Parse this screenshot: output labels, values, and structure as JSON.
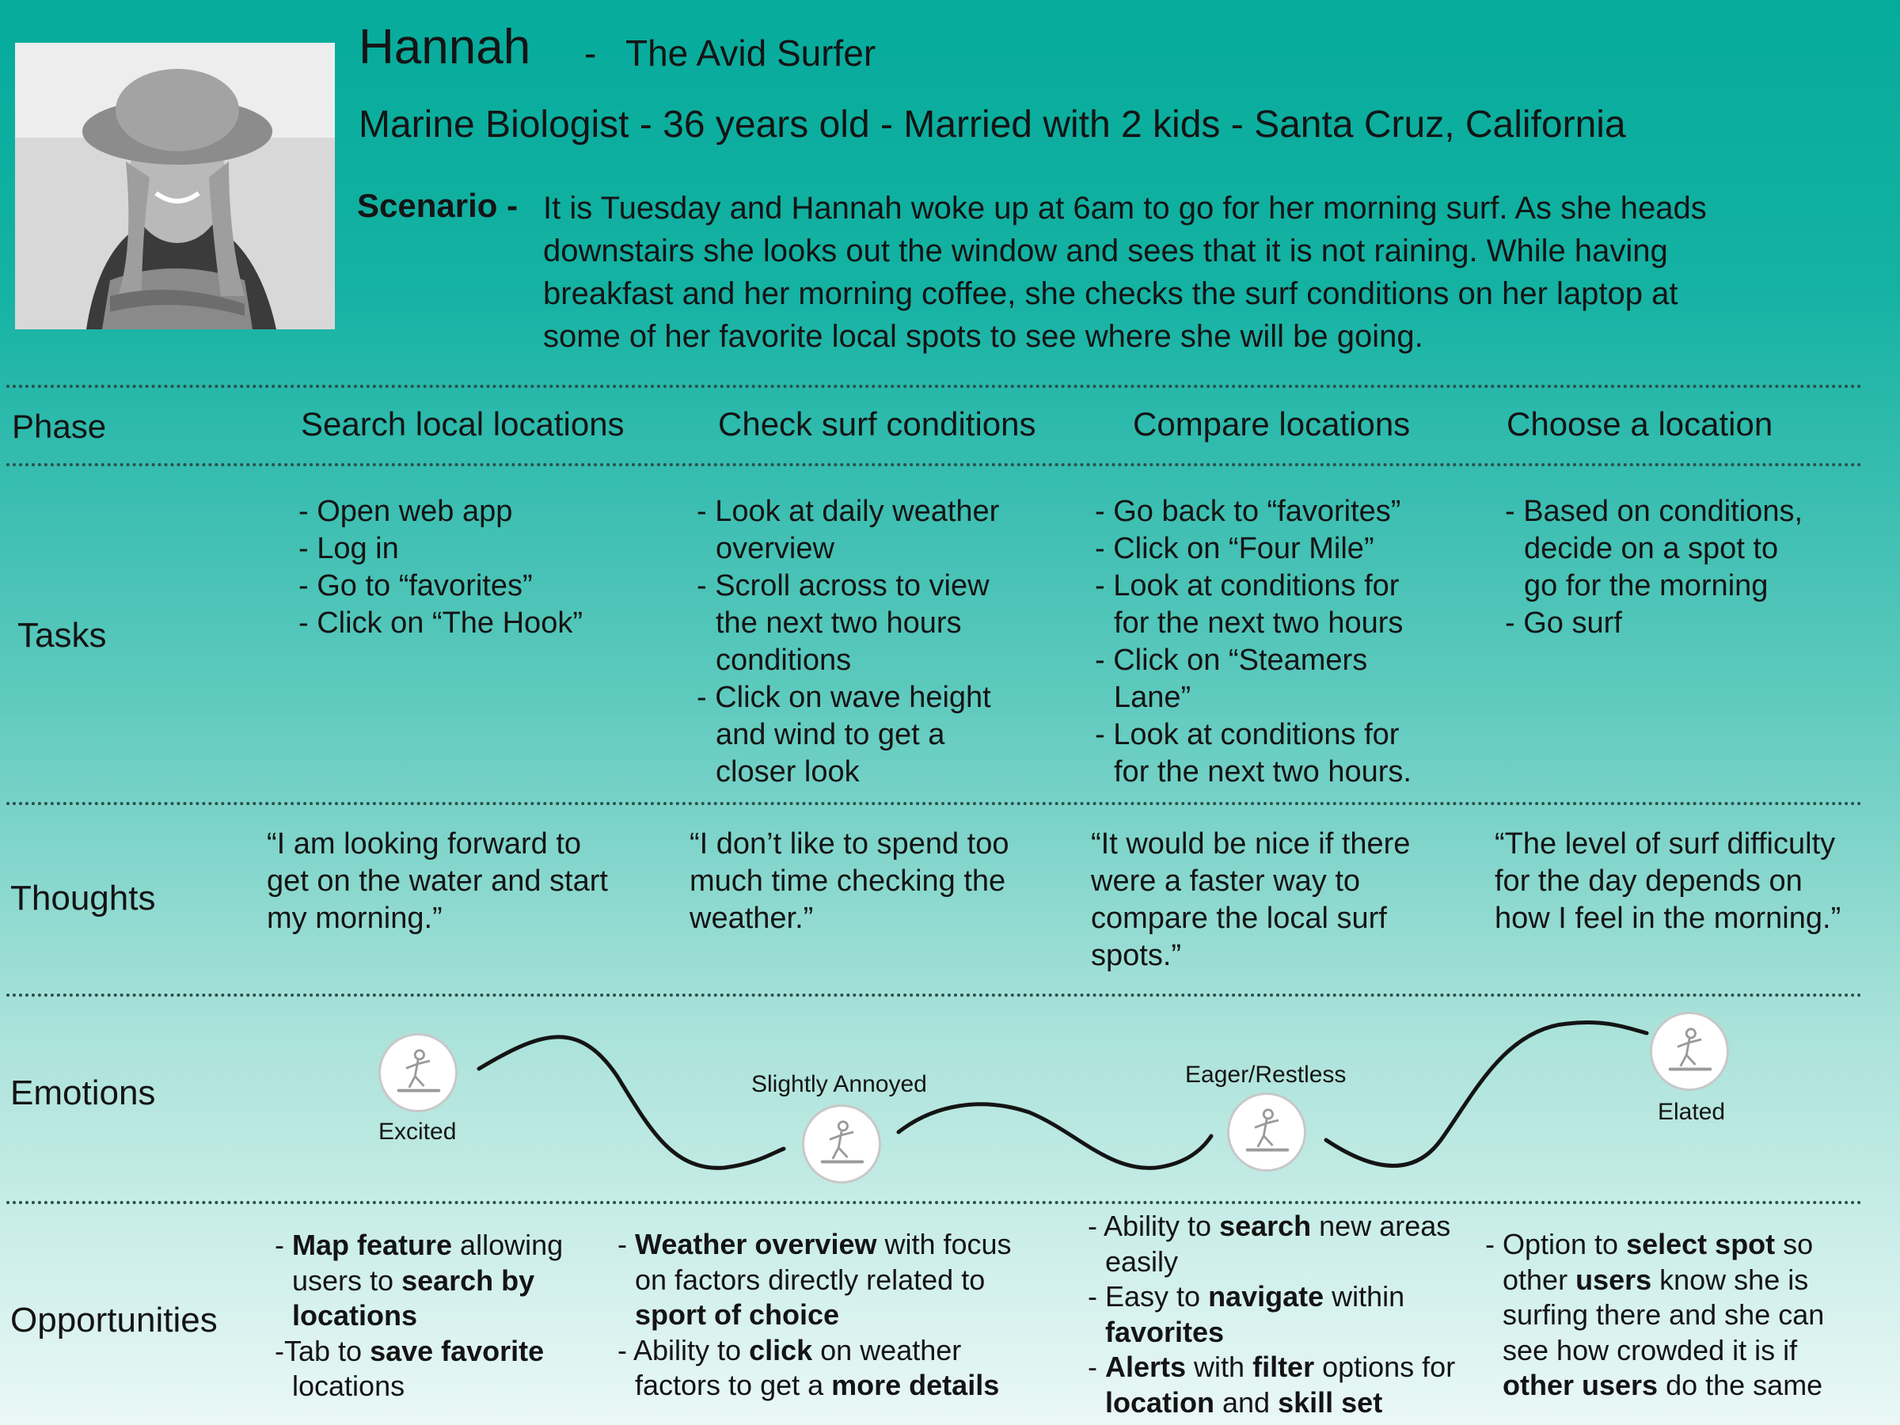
{
  "persona": {
    "name": "Hannah",
    "separator": "-",
    "tagline": "The Avid Surfer",
    "bio": "Marine Biologist  -  36 years old  -  Married with 2 kids  -  Santa Cruz, California",
    "scenario_label": "Scenario -",
    "scenario_lines": [
      "It is Tuesday and Hannah woke up at 6am to go for her morning surf.  As she heads",
      "downstairs she looks out the window and sees that it is not raining.  While having",
      "breakfast and her morning coffee, she checks the surf conditions on her laptop at",
      "some of her favorite local spots to see where she will be going."
    ]
  },
  "rows": {
    "phase": "Phase",
    "tasks": "Tasks",
    "thoughts": "Thoughts",
    "emotions": "Emotions",
    "opportunities": "Opportunities"
  },
  "phases": [
    "Search local locations",
    "Check surf conditions",
    "Compare locations",
    "Choose a location"
  ],
  "tasks": [
    [
      "- Open web app",
      "- Log in",
      "- Go to “favorites”",
      "- Click on “The Hook”"
    ],
    [
      "- Look at daily weather",
      "  overview",
      "- Scroll across to view",
      "  the next two hours",
      "  conditions",
      "- Click on wave height",
      "  and wind to get a",
      "  closer look"
    ],
    [
      "- Go back to “favorites”",
      "- Click on “Four Mile”",
      "- Look at conditions for",
      "  for the next two hours",
      "- Click on “Steamers",
      "   Lane”",
      "- Look at conditions for",
      "  for the next two hours."
    ],
    [
      "- Based on conditions,",
      "  decide on a spot to",
      "  go for the morning",
      "- Go surf"
    ]
  ],
  "thoughts": [
    [
      "“I am looking forward to",
      "get on the water and start",
      "my morning.”"
    ],
    [
      "“I don’t like to spend too",
      "much time checking the",
      "weather.”"
    ],
    [
      "“It would be nice if there",
      "were a faster way to",
      "compare the local surf",
      "spots.”"
    ],
    [
      "“The level of surf difficulty",
      "for the day depends on",
      "how I feel in the morning.”"
    ]
  ],
  "emotions": [
    {
      "label": "Excited",
      "icon": "surfer-icon"
    },
    {
      "label": "Slightly Annoyed",
      "icon": "surfer-icon"
    },
    {
      "label": "Eager/Restless",
      "icon": "surfer-icon"
    },
    {
      "label": "Elated",
      "icon": "surfer-icon"
    }
  ],
  "opportunities": {
    "col1": {
      "l1a": "- ",
      "l1b": "Map feature",
      "l1c": " allowing",
      "l2a": "users to ",
      "l2b": "search by",
      "l3b": "locations",
      "l4a": "-Tab to ",
      "l4b": "save favorite",
      "l5a": "locations"
    },
    "col2": {
      "l1a": "- ",
      "l1b": "Weather overview",
      "l1c": " with focus",
      "l2a": "on factors directly related to",
      "l3b": "sport of choice",
      "l4a": "- Ability to ",
      "l4b": "click",
      "l4c": " on weather",
      "l5a": "factors to get a ",
      "l5b": "more details"
    },
    "col3": {
      "l1a": "- Ability to ",
      "l1b": "search",
      "l1c": " new areas",
      "l2a": "easily",
      "l3a": "- Easy to ",
      "l3b": "navigate",
      "l3c": " within",
      "l4b": "favorites",
      "l5a": "- ",
      "l5b": "Alerts",
      "l5c": " with ",
      "l5d": "filter",
      "l5e": " options for",
      "l6b": "location",
      "l6c": " and ",
      "l6d": "skill set"
    },
    "col4": {
      "l1a": "- Option to ",
      "l1b": "select spot",
      "l1c": " so",
      "l2a": "other ",
      "l2b": "users",
      "l2c": " know she is",
      "l3a": "surfing there and she can",
      "l4a": "see how crowded it is if",
      "l5b": "other users",
      "l5c": " do the same"
    }
  },
  "colors": {
    "top": "#06ab9b",
    "bottom": "#eaf8f6",
    "text": "#141414",
    "divider": "#2b4f4a"
  }
}
